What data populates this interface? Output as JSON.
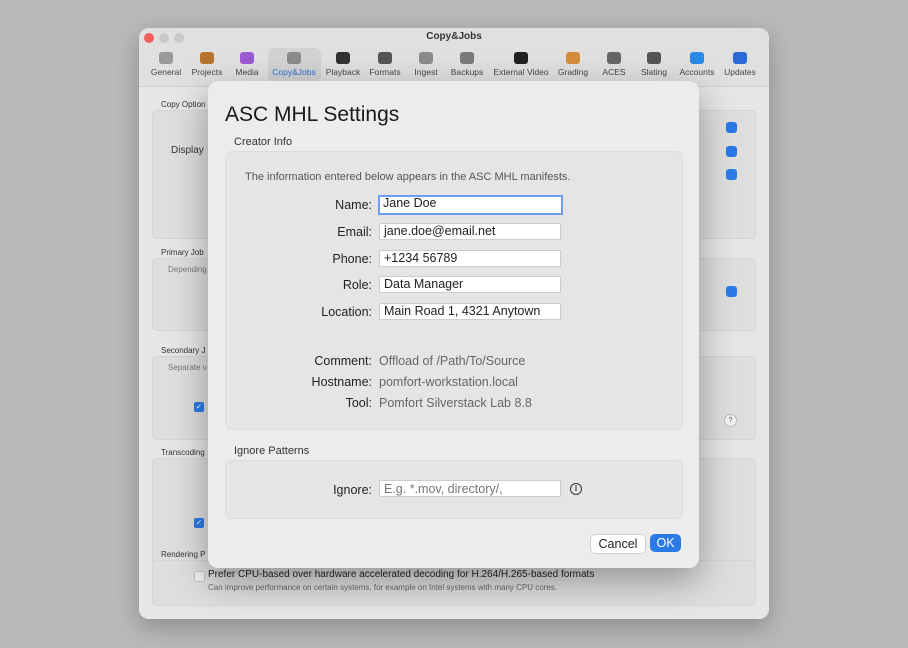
{
  "window": {
    "title": "Copy&Jobs",
    "traffic_lights": [
      "#ed5f57",
      "#c9c9c9",
      "#c9c9c9"
    ]
  },
  "toolbar": {
    "items": [
      {
        "label": "General",
        "icon": "general-icon",
        "color": "#9a9a9a"
      },
      {
        "label": "Projects",
        "icon": "projects-icon",
        "color": "#b8742f"
      },
      {
        "label": "Media",
        "icon": "media-icon",
        "color": "#9b5bd3"
      },
      {
        "label": "Copy&Jobs",
        "icon": "gear-icon",
        "color": "#8a8a8a",
        "selected": true
      },
      {
        "label": "Playback",
        "icon": "playback-icon",
        "color": "#333333"
      },
      {
        "label": "Formats",
        "icon": "formats-icon",
        "color": "#555555"
      },
      {
        "label": "Ingest",
        "icon": "ingest-icon",
        "color": "#8a8a8a"
      },
      {
        "label": "Backups",
        "icon": "backups-icon",
        "color": "#7a7a7a"
      },
      {
        "label": "External Video",
        "icon": "monitor-icon",
        "color": "#222222"
      },
      {
        "label": "Grading",
        "icon": "color-wheel-icon",
        "color": "#d58c3a"
      },
      {
        "label": "ACES",
        "icon": "aces-icon",
        "color": "#666666"
      },
      {
        "label": "Slating",
        "icon": "clapper-icon",
        "color": "#555555"
      },
      {
        "label": "Accounts",
        "icon": "at-icon",
        "color": "#2a8ae8"
      },
      {
        "label": "Updates",
        "icon": "updates-icon",
        "color": "#2a6ad8"
      }
    ]
  },
  "background": {
    "copy_options": "Copy Option",
    "display": "Display",
    "primary_job": "Primary Job",
    "primary_desc": "Depending",
    "secondary": "Secondary J",
    "secondary_desc": "Separate v",
    "transcoding": "Transcoding",
    "rendering": "Rendering P",
    "cpu_option": "Prefer CPU-based over hardware accelerated decoding for H.264/H.265-based formats",
    "cpu_desc": "Can improve performance on certain systems, for example on Intel systems with many CPU cores.",
    "help": "?"
  },
  "dialog": {
    "title": "ASC MHL Settings",
    "creator_header": "Creator Info",
    "info_text": "The information entered below appears in the ASC MHL manifests.",
    "fields": {
      "name_label": "Name:",
      "name_value": "Jane Doe",
      "email_label": "Email:",
      "email_value": "jane.doe@email.net",
      "phone_label": "Phone:",
      "phone_value": "+1234 56789",
      "role_label": "Role:",
      "role_value": "Data Manager",
      "location_label": "Location:",
      "location_value": "Main Road 1, 4321 Anytown"
    },
    "readonly": {
      "comment_label": "Comment:",
      "comment_value": "Offload of /Path/To/Source",
      "hostname_label": "Hostname:",
      "hostname_value": "pomfort-workstation.local",
      "tool_label": "Tool:",
      "tool_value": "Pomfort Silverstack Lab 8.8"
    },
    "ignore_header": "Ignore Patterns",
    "ignore_label": "Ignore:",
    "ignore_placeholder": "E.g. *.mov, directory/,",
    "info_icon": "i",
    "cancel_label": "Cancel",
    "ok_label": "OK"
  }
}
